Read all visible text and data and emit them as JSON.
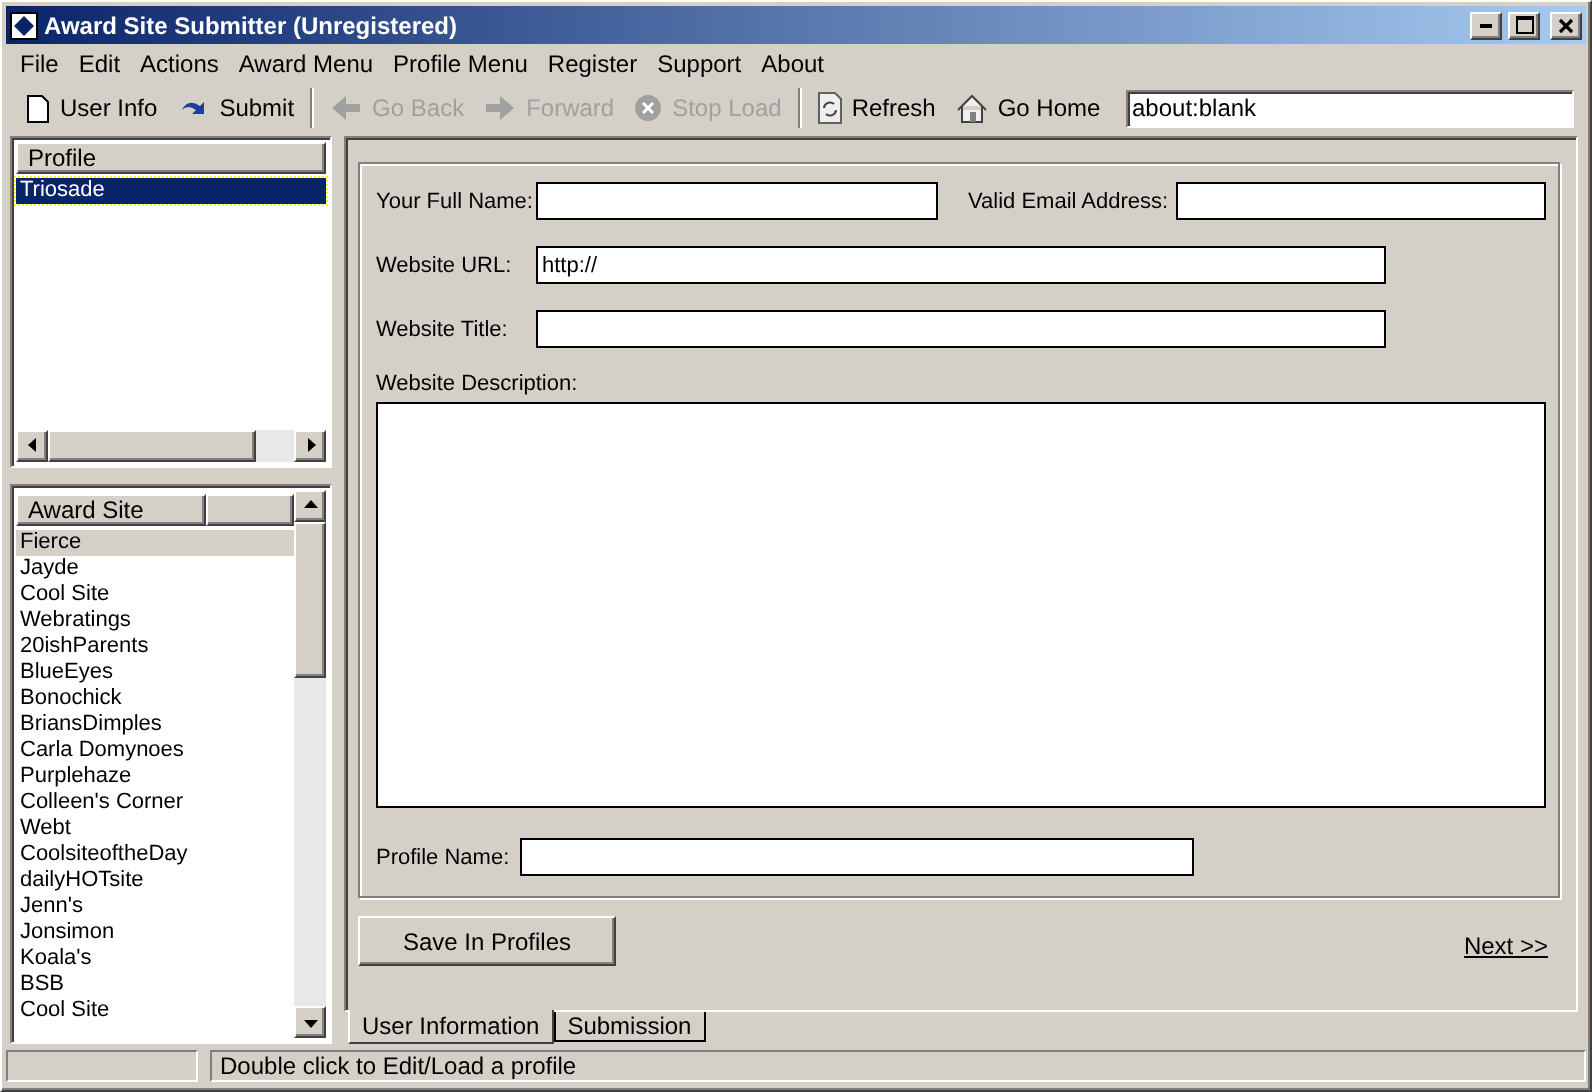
{
  "window": {
    "title": "Award Site Submitter (Unregistered)"
  },
  "menu": [
    "File",
    "Edit",
    "Actions",
    "Award Menu",
    "Profile Menu",
    "Register",
    "Support",
    "About"
  ],
  "toolbar": [
    {
      "kind": "page",
      "label": "User Info",
      "disabled": false
    },
    {
      "kind": "redo",
      "label": "Submit",
      "disabled": false
    },
    {
      "kind": "separator"
    },
    {
      "kind": "back",
      "label": "Go Back",
      "disabled": true
    },
    {
      "kind": "forward",
      "label": "Forward",
      "disabled": true
    },
    {
      "kind": "stop",
      "label": "Stop Load",
      "disabled": true
    },
    {
      "kind": "separator"
    },
    {
      "kind": "refresh",
      "label": "Refresh",
      "disabled": false
    },
    {
      "kind": "home",
      "label": "Go Home",
      "disabled": false
    }
  ],
  "address": {
    "value": "about:blank"
  },
  "profile_list": {
    "header": "Profile",
    "items": [
      {
        "label": "Triosade",
        "selected": true
      }
    ]
  },
  "award_list": {
    "header": "Award Site",
    "items": [
      {
        "label": "Fierce",
        "selected": true
      },
      {
        "label": "Jayde",
        "selected": false
      },
      {
        "label": "Cool Site",
        "selected": false
      },
      {
        "label": "Webratings",
        "selected": false
      },
      {
        "label": "20ishParents",
        "selected": false
      },
      {
        "label": "BlueEyes",
        "selected": false
      },
      {
        "label": "Bonochick",
        "selected": false
      },
      {
        "label": "BriansDimples",
        "selected": false
      },
      {
        "label": "Carla Domynoes",
        "selected": false
      },
      {
        "label": "Purplehaze",
        "selected": false
      },
      {
        "label": "Colleen's Corner",
        "selected": false
      },
      {
        "label": "Webt",
        "selected": false
      },
      {
        "label": "CoolsiteoftheDay",
        "selected": false
      },
      {
        "label": "dailyHOTsite",
        "selected": false
      },
      {
        "label": "Jenn's",
        "selected": false
      },
      {
        "label": "Jonsimon",
        "selected": false
      },
      {
        "label": "Koala's",
        "selected": false
      },
      {
        "label": "BSB",
        "selected": false
      },
      {
        "label": "Cool Site",
        "selected": false
      }
    ]
  },
  "form": {
    "full_name": {
      "label": "Your Full Name:"
    },
    "email": {
      "label": "Valid Email Address:"
    },
    "url": {
      "label": "Website URL:",
      "value": "http://"
    },
    "title": {
      "label": "Website Title:"
    },
    "description": {
      "label": "Website Description:"
    },
    "profile_name": {
      "label": "Profile Name:"
    }
  },
  "save_button": "Save In Profiles",
  "next_link": "Next >>",
  "tabs": [
    {
      "label": "User Information",
      "selected": true
    },
    {
      "label": "Submission",
      "selected": false
    }
  ],
  "status_bar": {
    "message": "Double click to Edit/Load a profile"
  }
}
